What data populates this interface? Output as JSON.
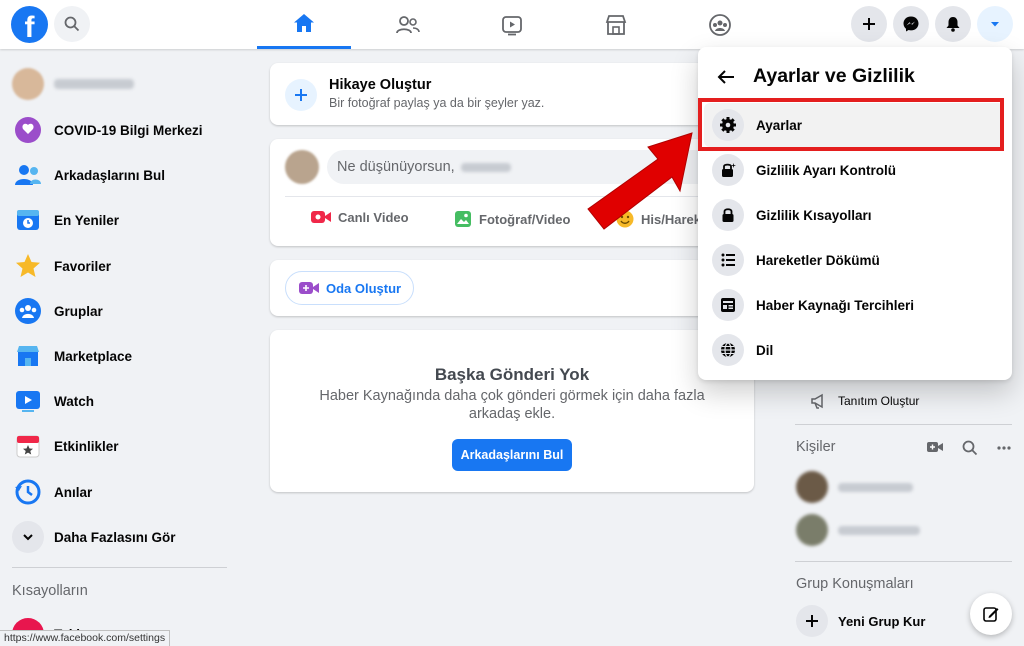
{
  "topbar": {
    "logo_letter": "f",
    "nav_tabs": [
      {
        "name": "home-icon",
        "active": true
      },
      {
        "name": "friends-icon",
        "active": false
      },
      {
        "name": "watch-icon",
        "active": false
      },
      {
        "name": "marketplace-icon",
        "active": false
      },
      {
        "name": "groups-icon",
        "active": false
      }
    ],
    "actions": [
      "plus-icon",
      "messenger-icon",
      "bell-icon",
      "caret-down-icon"
    ]
  },
  "sidebar": {
    "items": [
      {
        "label": "COVID-19 Bilgi Merkezi",
        "icon": "covid-info-icon"
      },
      {
        "label": "Arkadaşlarını Bul",
        "icon": "find-friends-icon"
      },
      {
        "label": "En Yeniler",
        "icon": "most-recent-icon"
      },
      {
        "label": "Favoriler",
        "icon": "star-icon"
      },
      {
        "label": "Gruplar",
        "icon": "groups-icon"
      },
      {
        "label": "Marketplace",
        "icon": "marketplace-icon"
      },
      {
        "label": "Watch",
        "icon": "watch-icon"
      },
      {
        "label": "Etkinlikler",
        "icon": "calendar-icon"
      },
      {
        "label": "Anılar",
        "icon": "memories-icon"
      },
      {
        "label": "Daha Fazlasını Gör",
        "icon": "chevron-down-icon"
      }
    ],
    "shortcuts_heading": "Kısayolların",
    "shortcut_item": "Takiye.com"
  },
  "story": {
    "title": "Hikaye Oluştur",
    "subtitle": "Bir fotoğraf paylaş ya da bir şeyler yaz."
  },
  "composer": {
    "prompt": "Ne düşünüyorsun,",
    "live_video": "Canlı Video",
    "photo_video": "Fotoğraf/Video",
    "feeling": "His/Hareket"
  },
  "room": {
    "label": "Oda Oluştur"
  },
  "no_posts": {
    "title": "Başka Gönderi Yok",
    "text": "Haber Kaynağında daha çok gönderi görmek için daha fazla arkadaş ekle.",
    "button": "Arkadaşlarını Bul"
  },
  "menu": {
    "title": "Ayarlar ve Gizlilik",
    "items": [
      {
        "label": "Ayarlar",
        "icon": "gear-icon"
      },
      {
        "label": "Gizlilik Ayarı Kontrolü",
        "icon": "privacy-lock-icon"
      },
      {
        "label": "Gizlilik Kısayolları",
        "icon": "lock-icon"
      },
      {
        "label": "Hareketler Dökümü",
        "icon": "list-icon"
      },
      {
        "label": "Haber Kaynağı Tercihleri",
        "icon": "feed-prefs-icon"
      },
      {
        "label": "Dil",
        "icon": "globe-icon"
      }
    ]
  },
  "right_rail": {
    "create_ad": "Tanıtım Oluştur",
    "contacts_heading": "Kişiler",
    "group_chats_heading": "Grup Konuşmaları",
    "new_group": "Yeni Grup Kur"
  },
  "status_url": "https://www.facebook.com/settings",
  "colors": {
    "accent": "#1877f2",
    "highlight": "#e41e1e"
  }
}
